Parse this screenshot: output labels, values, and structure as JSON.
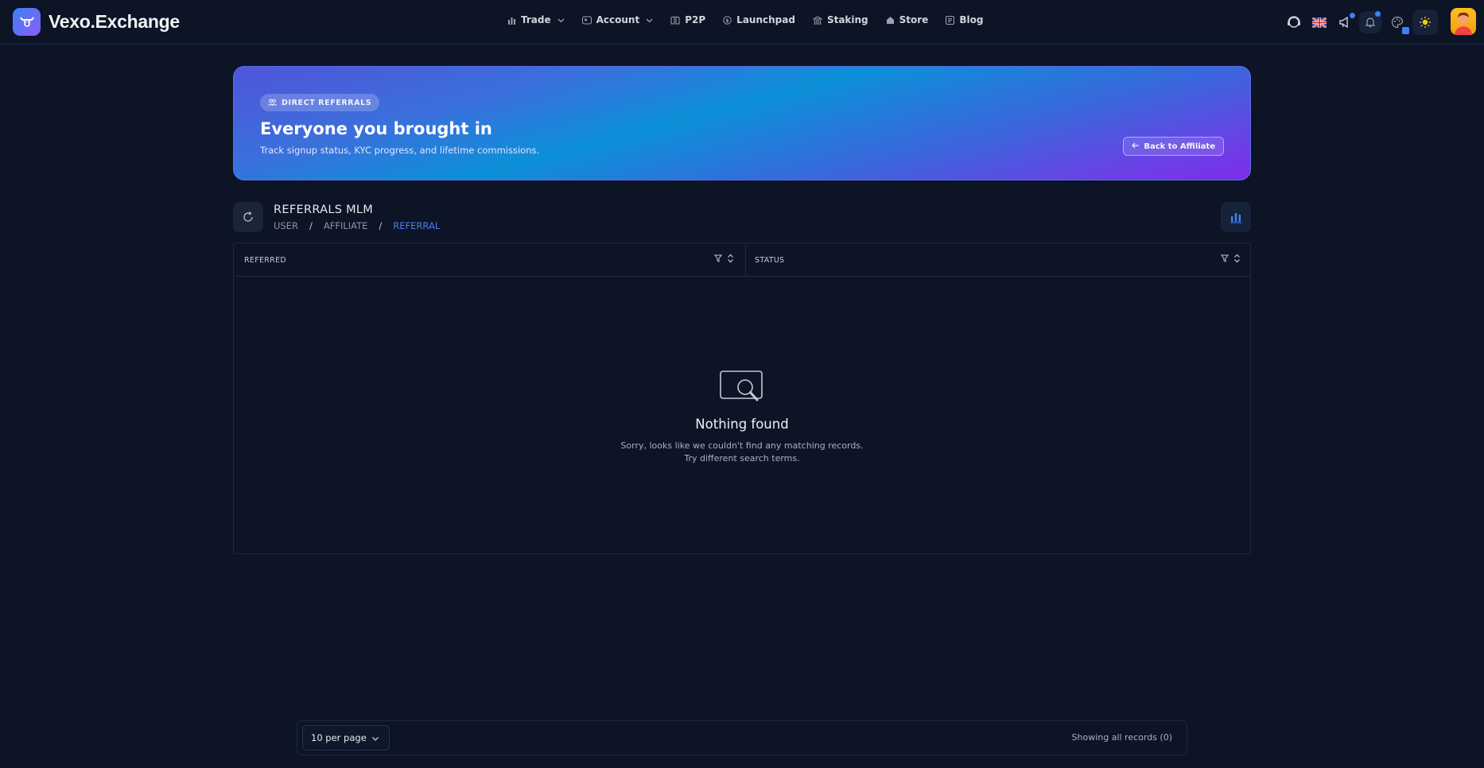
{
  "brand": {
    "name": "Vexo.Exchange"
  },
  "nav": {
    "items": [
      {
        "label": "Trade",
        "icon": "bar-chart-icon",
        "dropdown": true
      },
      {
        "label": "Account",
        "icon": "account-icon",
        "dropdown": true
      },
      {
        "label": "P2P",
        "icon": "p2p-icon",
        "dropdown": false
      },
      {
        "label": "Launchpad",
        "icon": "coin-icon",
        "dropdown": false
      },
      {
        "label": "Staking",
        "icon": "bank-icon",
        "dropdown": false
      },
      {
        "label": "Store",
        "icon": "store-icon",
        "dropdown": false
      },
      {
        "label": "Blog",
        "icon": "newspaper-icon",
        "dropdown": false
      }
    ]
  },
  "hero": {
    "badge": "DIRECT REFERRALS",
    "title": "Everyone you brought in",
    "subtitle": "Track signup status, KYC progress, and lifetime commissions.",
    "back_label": "Back to Affiliate"
  },
  "page": {
    "title": "REFERRALS MLM",
    "breadcrumbs": [
      "USER",
      "AFFILIATE",
      "REFERRAL"
    ]
  },
  "table": {
    "columns": [
      "REFERRED",
      "STATUS"
    ],
    "rows": [],
    "empty_title": "Nothing found",
    "empty_line1": "Sorry, looks like we couldn't find any matching records.",
    "empty_line2": "Try different search terms."
  },
  "pagination": {
    "per_page": "10 per page",
    "records": "Showing all records (0)"
  },
  "colors": {
    "background": "#0c1426",
    "accent": "#3b82f6",
    "breadcrumb_active": "#4f7bf0"
  }
}
